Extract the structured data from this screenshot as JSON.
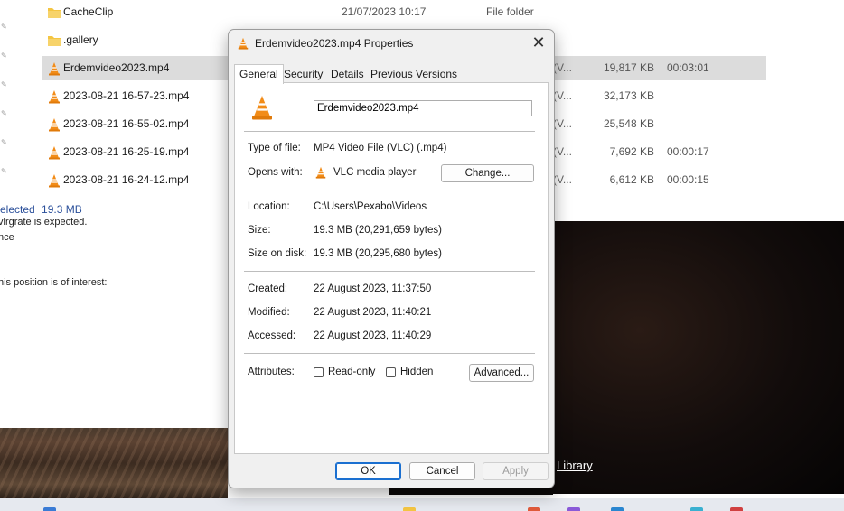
{
  "explorer": {
    "rows": [
      {
        "name": "CacheClip",
        "date": "21/07/2023 10:17",
        "type": "File folder",
        "size": "",
        "length": "",
        "icon": "folder-icon"
      },
      {
        "name": ".gallery",
        "date": "",
        "type": "",
        "size": "",
        "length": "",
        "icon": "folder-icon"
      },
      {
        "name": "Erdemvideo2023.mp4",
        "date": "",
        "type": "e (V...",
        "size": "19,817 KB",
        "length": "00:03:01",
        "icon": "vlc-icon",
        "selected": true
      },
      {
        "name": "2023-08-21 16-57-23.mp4",
        "date": "",
        "type": "e (V...",
        "size": "32,173 KB",
        "length": "",
        "icon": "vlc-icon"
      },
      {
        "name": "2023-08-21 16-55-02.mp4",
        "date": "",
        "type": "e (V...",
        "size": "25,548 KB",
        "length": "",
        "icon": "vlc-icon"
      },
      {
        "name": "2023-08-21 16-25-19.mp4",
        "date": "",
        "type": "e (V...",
        "size": "7,692 KB",
        "length": "00:00:17",
        "icon": "vlc-icon"
      },
      {
        "name": "2023-08-21 16-24-12.mp4",
        "date": "",
        "type": "e (V...",
        "size": "6,612 KB",
        "length": "00:00:15",
        "icon": "vlc-icon"
      }
    ],
    "status": {
      "selected_label": "elected",
      "selected_size": "19.3 MB"
    }
  },
  "document": {
    "lines": [
      "vlrgrate is expected.",
      "nce",
      "his position is of interest:"
    ]
  },
  "background": {
    "library_link": "Library"
  },
  "dialog": {
    "title": "Erdemvideo2023.mp4 Properties",
    "tabs": [
      "General",
      "Security",
      "Details",
      "Previous Versions"
    ],
    "active_tab": "General",
    "filename": "Erdemvideo2023.mp4",
    "type_label": "Type of file:",
    "type_value": "MP4 Video File (VLC) (.mp4)",
    "opens_label": "Opens with:",
    "opens_value": "VLC media player",
    "change_label": "Change...",
    "location_label": "Location:",
    "location_value": "C:\\Users\\Pexabo\\Videos",
    "size_label": "Size:",
    "size_value": "19.3 MB (20,291,659 bytes)",
    "size_disk_label": "Size on disk:",
    "size_disk_value": "19.3 MB (20,295,680 bytes)",
    "created_label": "Created:",
    "created_value": "22 August 2023, 11:37:50",
    "modified_label": "Modified:",
    "modified_value": "22 August 2023, 11:40:21",
    "accessed_label": "Accessed:",
    "accessed_value": "22 August 2023, 11:40:29",
    "attributes_label": "Attributes:",
    "readonly_label": "Read-only",
    "hidden_label": "Hidden",
    "advanced_label": "Advanced...",
    "ok_label": "OK",
    "cancel_label": "Cancel",
    "apply_label": "Apply"
  },
  "colors": {
    "accent": "#1a6fd0",
    "vlc_orange": "#f28c18",
    "folder_yellow": "#f4c542",
    "selected_row": "#dcdcdc"
  }
}
